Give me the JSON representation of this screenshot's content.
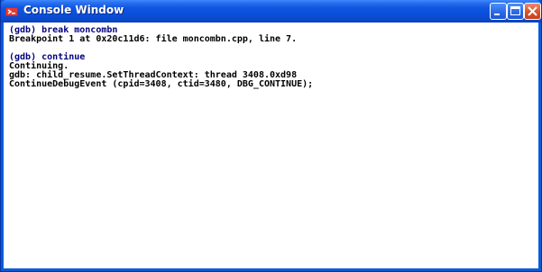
{
  "window": {
    "title": "Console Window"
  },
  "titlebar": {
    "buttons": [
      "minimize",
      "maximize",
      "close"
    ]
  },
  "console": {
    "lines": [
      "(gdb) break moncombn",
      "Breakpoint 1 at 0x20c11d6: file moncombn.cpp, line 7.",
      "",
      "(gdb) continue",
      "Continuing.",
      "gdb: child_resume.SetThreadContext: thread 3408.0xd98",
      "ContinueDebugEvent (cpid=3408, ctid=3480, DBG_CONTINUE);"
    ]
  },
  "colors": {
    "titlebar": "#0a4fd8",
    "prompt_text": "#000080",
    "output_text": "#000000",
    "close_button": "#d9532d"
  }
}
